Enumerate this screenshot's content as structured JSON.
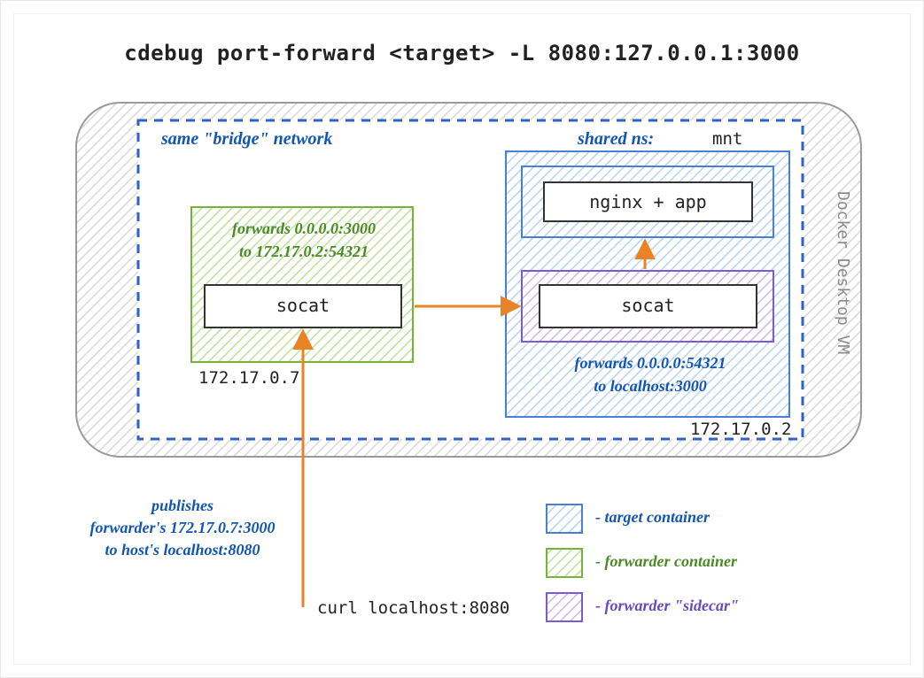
{
  "title": "cdebug port-forward <target> -L 8080:127.0.0.1:3000",
  "bridge_label": "same \"bridge\" network",
  "shared_ns": "shared ns:",
  "mnt": "mnt",
  "nginx": "nginx + app",
  "green_forwards_l1": "forwards 0.0.0.0:3000",
  "green_forwards_l2": "to 172.17.0.2:54321",
  "socat": "socat",
  "blue_forwards_l1": "forwards 0.0.0.0:54321",
  "blue_forwards_l2": "to localhost:3000",
  "ip_left": "172.17.0.7",
  "ip_right": "172.17.0.2",
  "docker_vm": "Docker Desktop VM",
  "publishes_l1": "publishes",
  "publishes_l2": "forwarder's 172.17.0.7:3000",
  "publishes_l3": "to host's localhost:8080",
  "curl": "curl localhost:8080",
  "legend": {
    "target": "- target container",
    "forwarder": "- forwarder container",
    "sidecar": "- forwarder \"sidecar\""
  },
  "colors": {
    "blue": "#4a7fd6",
    "blueHatch": "#b7d4f8",
    "green": "#76b33a",
    "greenHatch": "#bfe29a",
    "purple": "#7a5cd0",
    "purpleHatch": "#c9b8f0",
    "orange": "#e88426",
    "gray": "#9b9b9b",
    "grayHatch": "#d9d9d9"
  }
}
